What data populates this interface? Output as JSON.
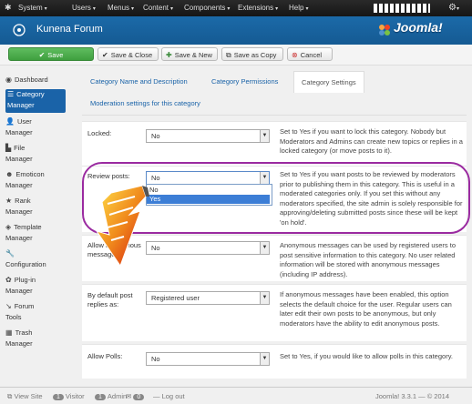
{
  "topbar": {
    "menus": [
      {
        "label": "System"
      },
      {
        "label": "Users"
      },
      {
        "label": "Menus"
      },
      {
        "label": "Content"
      },
      {
        "label": "Components"
      },
      {
        "label": "Extensions"
      },
      {
        "label": "Help"
      }
    ],
    "gear_icon": "gear-icon",
    "caret": "▾"
  },
  "header": {
    "title": "Kunena Forum",
    "logo_text": "Joomla!"
  },
  "toolbar": {
    "save": "Save",
    "save_close": "Save & Close",
    "save_new": "Save & New",
    "save_copy": "Save as Copy",
    "cancel": "Cancel"
  },
  "sidebar": {
    "items": [
      {
        "line1": "Dashboard",
        "line2": "",
        "icon": "dashboard-icon"
      },
      {
        "line1": "Category",
        "line2": "Manager",
        "icon": "category-icon",
        "active": true
      },
      {
        "line1": "User",
        "line2": "Manager",
        "icon": "user-icon"
      },
      {
        "line1": "File",
        "line2": "Manager",
        "icon": "file-icon"
      },
      {
        "line1": "Emoticon",
        "line2": "Manager",
        "icon": "emoticon-icon"
      },
      {
        "line1": "Rank",
        "line2": "Manager",
        "icon": "rank-icon"
      },
      {
        "line1": "Template",
        "line2": "Manager",
        "icon": "template-icon"
      },
      {
        "line1": "",
        "line2": "Configuration",
        "icon": "wrench-icon"
      },
      {
        "line1": "Plug-in",
        "line2": "Manager",
        "icon": "plugin-icon"
      },
      {
        "line1": "Forum",
        "line2": "Tools",
        "icon": "tools-icon"
      },
      {
        "line1": "Trash",
        "line2": "Manager",
        "icon": "trash-icon"
      }
    ]
  },
  "tabs": [
    {
      "label": "Category Name and Description"
    },
    {
      "label": "Category Permissions"
    },
    {
      "label": "Category Settings",
      "active": true
    },
    {
      "label": "Moderation settings for this category"
    }
  ],
  "settings": [
    {
      "label": "Locked:",
      "value": "No",
      "desc": "Set to Yes if you want to lock this category. Nobody but Moderators and Admins can create new topics or replies in a locked category (or move posts to it)."
    },
    {
      "label": "Review posts:",
      "value": "No",
      "desc": "Set to Yes if you want posts to be reviewed by moderators prior to publishing them in this category. This is useful in a moderated categories only. If you set this without any moderators specified, the site admin is solely responsible for approving/deleting submitted posts since these will be kept 'on hold'.",
      "options": [
        "No",
        "Yes"
      ],
      "highlighted_option": "Yes"
    },
    {
      "label": "Allow anonymous messages:",
      "value": "No",
      "desc": "Anonymous messages can be used by registered users to post sensitive information to this category. No user related information will be stored with anonymous messages (including IP address)."
    },
    {
      "label": "By default post replies as:",
      "value": "Registered user",
      "desc": "If anonymous messages have been enabled, this option selects the default choice for the user. Regular users can later edit their own posts to be anonymous, but only moderators have the ability to edit anonymous posts."
    },
    {
      "label": "Allow Polls:",
      "value": "No",
      "desc": "Set to Yes, if you would like to allow polls in this category."
    }
  ],
  "statusbar": {
    "view_site": "View Site",
    "visitor_count": "1",
    "visitor_label": "Visitor",
    "admin_count": "1",
    "admin_label": "Admin",
    "mail_count": "0",
    "logout": "Log out",
    "version": "Joomla! 3.3.1 — © 2014"
  },
  "colors": {
    "header": "#1a5e9a",
    "save_button": "#4aa84a",
    "accent": "#1a63a8",
    "highlight_oval": "#9a2aa0"
  }
}
